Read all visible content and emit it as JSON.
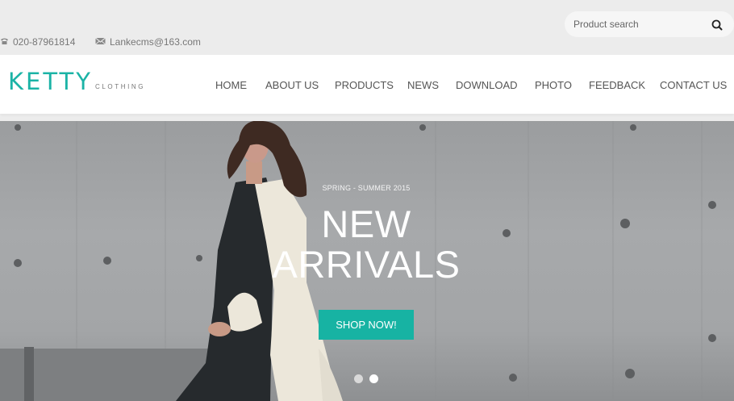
{
  "search": {
    "placeholder": "Product search",
    "icon": "search-icon"
  },
  "contact": {
    "phone": "020-87961814",
    "email": "Lankecms@163.com"
  },
  "logo": {
    "main": "KETTY",
    "sub": "CLOTHING"
  },
  "nav": {
    "items": [
      {
        "label": "HOME"
      },
      {
        "label": "ABOUT US"
      },
      {
        "label": "PRODUCTS"
      },
      {
        "label": "NEWS"
      },
      {
        "label": "DOWNLOAD"
      },
      {
        "label": "PHOTO"
      },
      {
        "label": "FEEDBACK"
      },
      {
        "label": "CONTACT US"
      }
    ]
  },
  "hero": {
    "season": "SPRING - SUMMER 2015",
    "headline_line1": "NEW",
    "headline_line2": "ARRIVALS",
    "cta_label": "SHOP NOW!",
    "slides_total": 2,
    "active_slide": 2
  },
  "colors": {
    "accent": "#1bb3a6",
    "nav_text": "#555555",
    "top_bg": "#ececec"
  }
}
